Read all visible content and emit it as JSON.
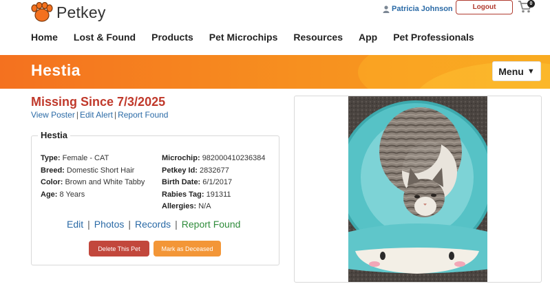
{
  "header": {
    "logo_text": "Petkey",
    "user_name": "Patricia Johnson",
    "logout_label": "Logout",
    "cart_count": "0"
  },
  "nav": {
    "items": [
      "Home",
      "Lost & Found",
      "Products",
      "Pet Microchips",
      "Resources",
      "App",
      "Pet Professionals"
    ]
  },
  "banner": {
    "pet_name": "Hestia",
    "menu_label": "Menu",
    "menu_caret": "▼"
  },
  "alert": {
    "status": "Missing Since 7/3/2025",
    "links": [
      "View Poster",
      "Edit Alert",
      "Report Found"
    ],
    "separator": "|"
  },
  "pet": {
    "name": "Hestia",
    "details_left": [
      {
        "label": "Type:",
        "value": "Female - CAT"
      },
      {
        "label": "Breed:",
        "value": "Domestic Short Hair"
      },
      {
        "label": "Color:",
        "value": "Brown and White Tabby"
      },
      {
        "label": "Age:",
        "value": "8 Years"
      }
    ],
    "details_right": [
      {
        "label": "Microchip:",
        "value": "982000410236384"
      },
      {
        "label": "Petkey Id:",
        "value": "2832677"
      },
      {
        "label": "Birth Date:",
        "value": "6/1/2017"
      },
      {
        "label": "Rabies Tag:",
        "value": "191311"
      },
      {
        "label": "Allergies:",
        "value": "N/A"
      }
    ],
    "actions": [
      "Edit",
      "Photos",
      "Records",
      "Report Found"
    ],
    "delete_label": "Delete This Pet",
    "deceased_label": "Mark as Deceased"
  },
  "colors": {
    "accent_orange": "#f4711f",
    "missing_red": "#c0392b",
    "link_blue": "#2a6aa6",
    "found_green": "#2e8b3a"
  }
}
